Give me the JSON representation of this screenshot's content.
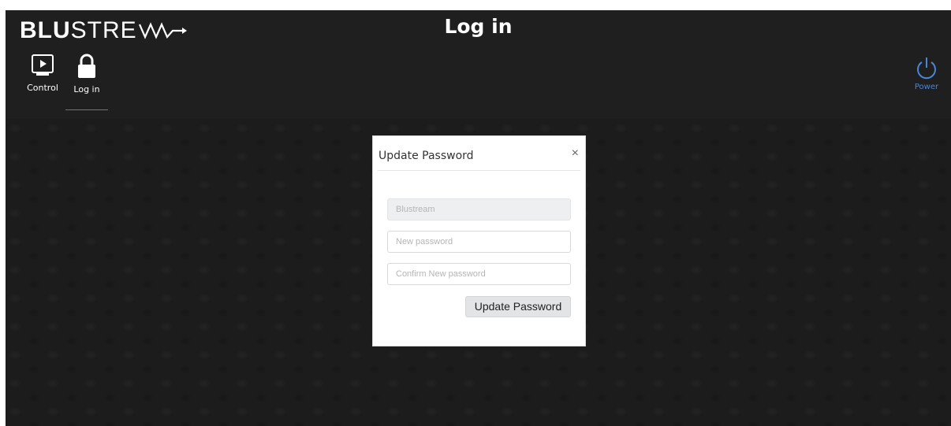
{
  "header": {
    "logo_bold": "BLU",
    "logo_light": "STRE",
    "title": "Log in"
  },
  "nav": {
    "items": [
      {
        "label": "Control",
        "icon": "tv-play-icon"
      },
      {
        "label": "Log in",
        "icon": "lock-icon",
        "active": true
      }
    ],
    "power": {
      "label": "Power",
      "icon": "power-icon",
      "color": "#4a86d6"
    }
  },
  "modal": {
    "title": "Update Password",
    "close_glyph": "×",
    "username_placeholder": "Blustream",
    "new_password_placeholder": "New password",
    "confirm_password_placeholder": "Confirm New password",
    "submit_label": "Update Password"
  },
  "colors": {
    "background": "#1f1f20",
    "accent": "#3f7bd0"
  }
}
